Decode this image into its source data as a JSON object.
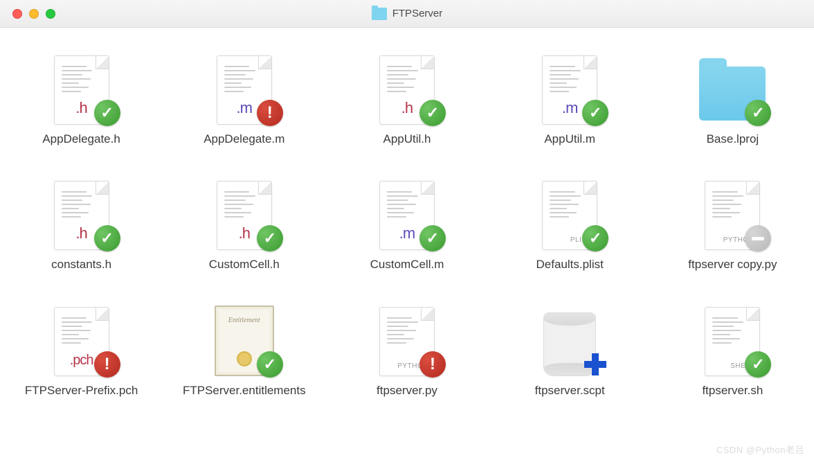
{
  "window": {
    "title": "FTPServer"
  },
  "files": [
    {
      "name": "AppDelegate.h",
      "icon": "doc",
      "ext": ".h",
      "extClass": "ext-h",
      "badge": "check"
    },
    {
      "name": "AppDelegate.m",
      "icon": "doc",
      "ext": ".m",
      "extClass": "ext-m",
      "badge": "warn"
    },
    {
      "name": "AppUtil.h",
      "icon": "doc",
      "ext": ".h",
      "extClass": "ext-h",
      "badge": "check"
    },
    {
      "name": "AppUtil.m",
      "icon": "doc",
      "ext": ".m",
      "extClass": "ext-m",
      "badge": "check"
    },
    {
      "name": "Base.lproj",
      "icon": "folder",
      "badge": "check"
    },
    {
      "name": "constants.h",
      "icon": "doc",
      "ext": ".h",
      "extClass": "ext-h",
      "badge": "check"
    },
    {
      "name": "CustomCell.h",
      "icon": "doc",
      "ext": ".h",
      "extClass": "ext-h",
      "badge": "check"
    },
    {
      "name": "CustomCell.m",
      "icon": "doc",
      "ext": ".m",
      "extClass": "ext-m",
      "badge": "check"
    },
    {
      "name": "Defaults.plist",
      "icon": "doc",
      "tag": "PLIST",
      "badge": "check"
    },
    {
      "name": "ftpserver copy.py",
      "icon": "doc",
      "tag": "PYTHON",
      "badge": "ignore"
    },
    {
      "name": "FTPServer-Prefix.pch",
      "icon": "doc",
      "ext": ".pch",
      "extClass": "ext-pch",
      "badge": "warn"
    },
    {
      "name": "FTPServer.entitlements",
      "icon": "cert",
      "badge": "check"
    },
    {
      "name": "ftpserver.py",
      "icon": "doc",
      "tag": "PYTHON",
      "badge": "warn"
    },
    {
      "name": "ftpserver.scpt",
      "icon": "scroll",
      "badge": "plus"
    },
    {
      "name": "ftpserver.sh",
      "icon": "doc",
      "tag": "SHELL",
      "badge": "check"
    }
  ],
  "cert_label": "Entitlement",
  "watermark": "CSDN @Python老吕"
}
